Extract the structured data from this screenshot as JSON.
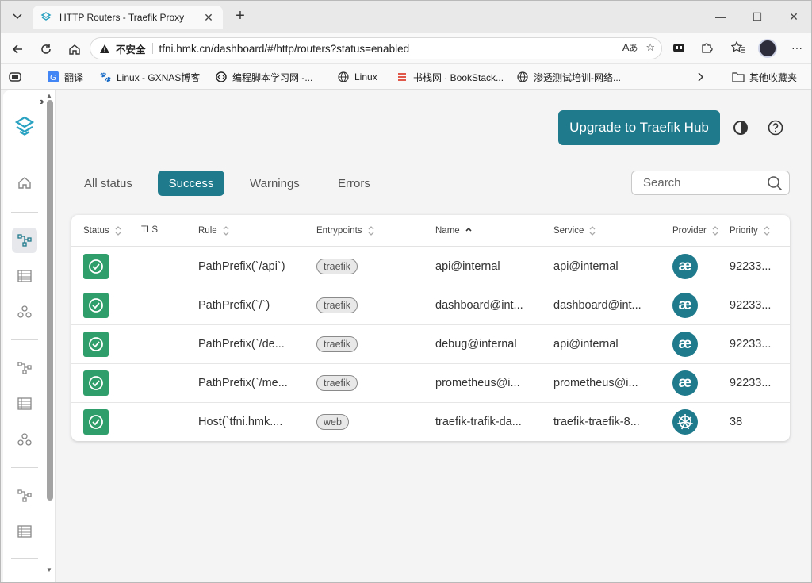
{
  "browser": {
    "tab_title": "HTTP Routers - Traefik Proxy",
    "insecure_label": "不安全",
    "url": "tfni.hmk.cn/dashboard/#/http/routers?status=enabled",
    "bookmarks": [
      {
        "label": "翻译",
        "icon": "translate-icon"
      },
      {
        "label": "Linux - GXNAS博客",
        "icon": "gxnas-icon"
      },
      {
        "label": "编程脚本学习网 -...",
        "icon": "code-icon"
      },
      {
        "label": "Linux",
        "icon": "globe-icon"
      },
      {
        "label": "书栈网 · BookStack...",
        "icon": "bookstack-icon"
      },
      {
        "label": "渗透测试培训-网络...",
        "icon": "globe-icon"
      }
    ],
    "other_bookmarks": "其他收藏夹"
  },
  "header": {
    "upgrade_label": "Upgrade to Traefik Hub"
  },
  "filters": {
    "tabs": [
      "All status",
      "Success",
      "Warnings",
      "Errors"
    ],
    "active": "Success"
  },
  "search": {
    "placeholder": "Search"
  },
  "table": {
    "columns": [
      "Status",
      "TLS",
      "Rule",
      "Entrypoints",
      "Name",
      "Service",
      "Provider",
      "Priority"
    ],
    "rows": [
      {
        "rule": "PathPrefix(`/api`)",
        "entrypoint": "traefik",
        "name": "api@internal",
        "service": "api@internal",
        "provider": "internal",
        "priority": "92233..."
      },
      {
        "rule": "PathPrefix(`/`)",
        "entrypoint": "traefik",
        "name": "dashboard@int...",
        "service": "dashboard@int...",
        "provider": "internal",
        "priority": "92233..."
      },
      {
        "rule": "PathPrefix(`/de...",
        "entrypoint": "traefik",
        "name": "debug@internal",
        "service": "api@internal",
        "provider": "internal",
        "priority": "92233..."
      },
      {
        "rule": "PathPrefix(`/me...",
        "entrypoint": "traefik",
        "name": "prometheus@i...",
        "service": "prometheus@i...",
        "provider": "internal",
        "priority": "92233..."
      },
      {
        "rule": "Host(`tfni.hmk....",
        "entrypoint": "web",
        "name": "traefik-trafik-da...",
        "service": "traefik-traefik-8...",
        "provider": "kubernetes",
        "priority": "38"
      }
    ]
  },
  "colors": {
    "accent": "#1f7a8c",
    "success": "#2f9e6a"
  }
}
